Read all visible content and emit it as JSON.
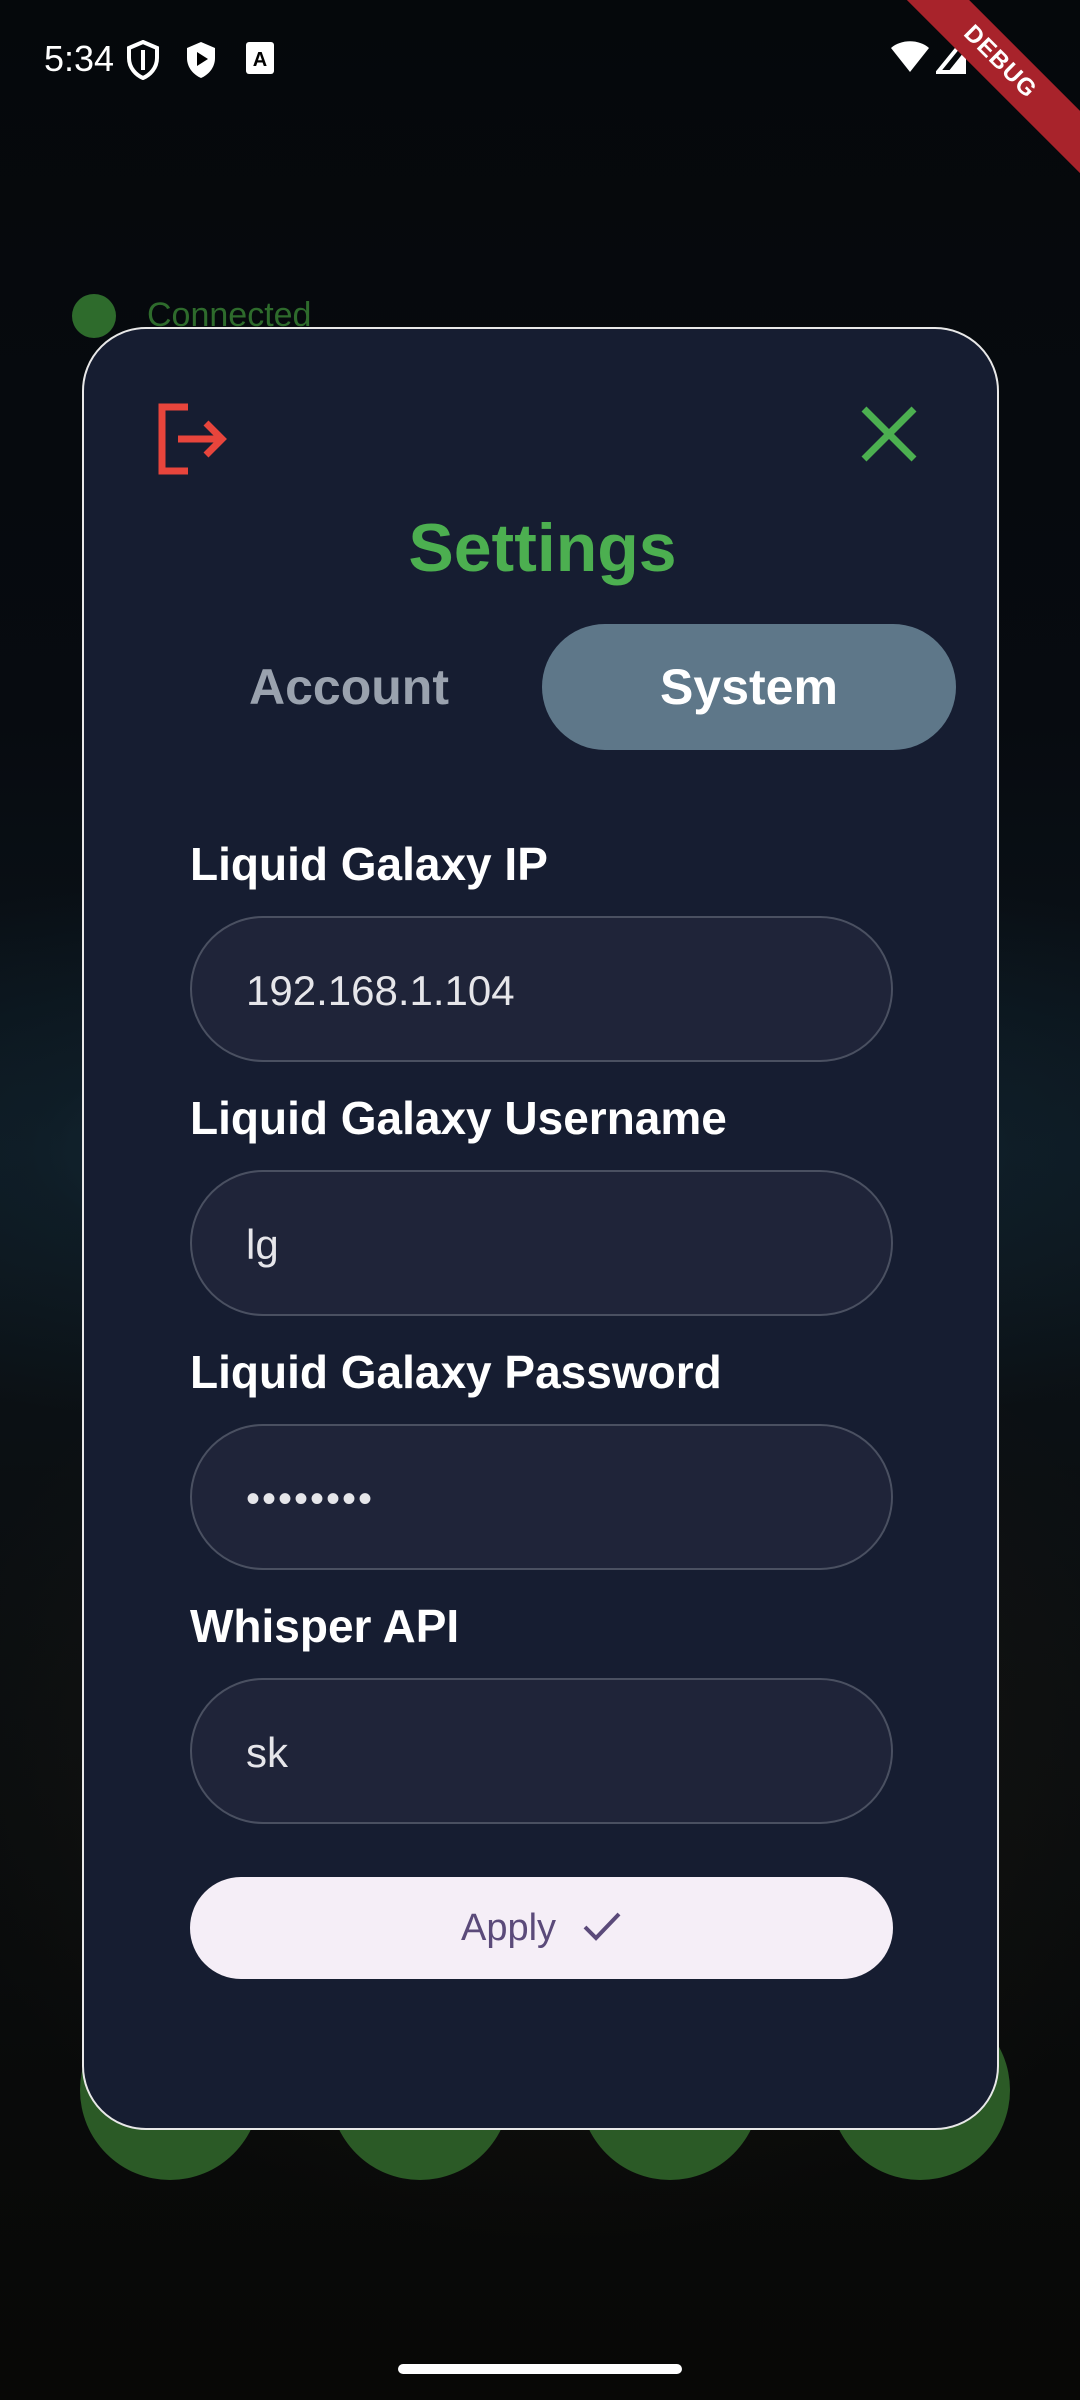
{
  "status_bar": {
    "time": "5:34",
    "left_icons": [
      "shield-icon",
      "play-shield-icon",
      "text-box-icon"
    ],
    "right_icons": [
      "wifi-icon",
      "signal-icon",
      "battery-icon"
    ],
    "debug_banner": "DEBUG"
  },
  "background": {
    "connection_status": "Connected",
    "status_color": "#2e6b2c"
  },
  "dialog": {
    "title": "Settings",
    "logout_icon": "logout-icon",
    "close_icon": "close-icon",
    "tabs": [
      {
        "label": "Account",
        "selected": false
      },
      {
        "label": "System",
        "selected": true
      }
    ],
    "fields": [
      {
        "label": "Liquid Galaxy IP",
        "value": "192.168.1.104"
      },
      {
        "label": "Liquid Galaxy Username",
        "value": "lg"
      },
      {
        "label": "Liquid Galaxy Password",
        "value": "••••••••"
      },
      {
        "label": "Whisper API",
        "value": "sk"
      }
    ],
    "apply_button": {
      "label": "Apply",
      "icon": "check-icon"
    }
  },
  "colors": {
    "accent_green": "#4caf50",
    "logout_red": "#e8453c",
    "dialog_bg": "#161d31",
    "selected_tab": "#5e7789",
    "button_bg": "#f5eef7",
    "button_text": "#5b4a7a"
  }
}
